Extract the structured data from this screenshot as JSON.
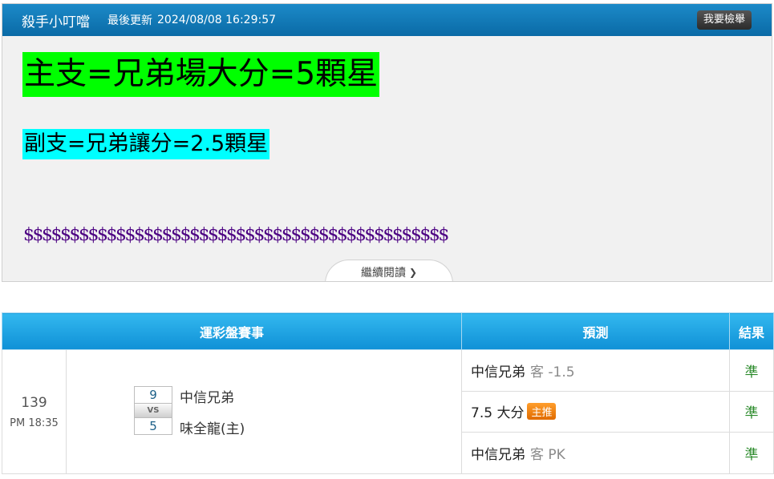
{
  "post": {
    "author": "殺手小叮噹",
    "updated_label": "最後更新",
    "updated_time": "2024/08/08 16:29:57",
    "report_button": "我要檢舉",
    "line_main": "主支=兄弟場大分=5顆星",
    "line_sub": "副支=兄弟讓分=2.5顆星",
    "line_dollar": "$$$$$$$$$$$$$$$$$$$$$$$$$$$$$$$$$$$$$$$$$$$$$$",
    "read_more": "繼續閱讀"
  },
  "colors": {
    "highlight_main": "#00ff00",
    "highlight_sub": "#00ffff",
    "dollar_text": "#4b0082",
    "result_text": "#2a8a2a",
    "header_blue": "#1c8ac8"
  },
  "table": {
    "headers": {
      "game": "運彩盤賽事",
      "prediction": "預測",
      "result": "結果"
    },
    "game": {
      "number": "139",
      "time": "PM 18:35",
      "home_score": "9",
      "away_score": "5",
      "vs": "VS",
      "home_team": "中信兄弟",
      "away_team": "味全龍(主)"
    },
    "predictions": [
      {
        "pick": "中信兄弟",
        "extra": "客 -1.5",
        "badge": "",
        "result": "準"
      },
      {
        "pick": "7.5 大分",
        "extra": "",
        "badge": "主推",
        "result": "準"
      },
      {
        "pick": "中信兄弟",
        "extra": "客 PK",
        "badge": "",
        "result": "準"
      }
    ]
  },
  "icons": {
    "read_more": "chevron-down-icon"
  }
}
